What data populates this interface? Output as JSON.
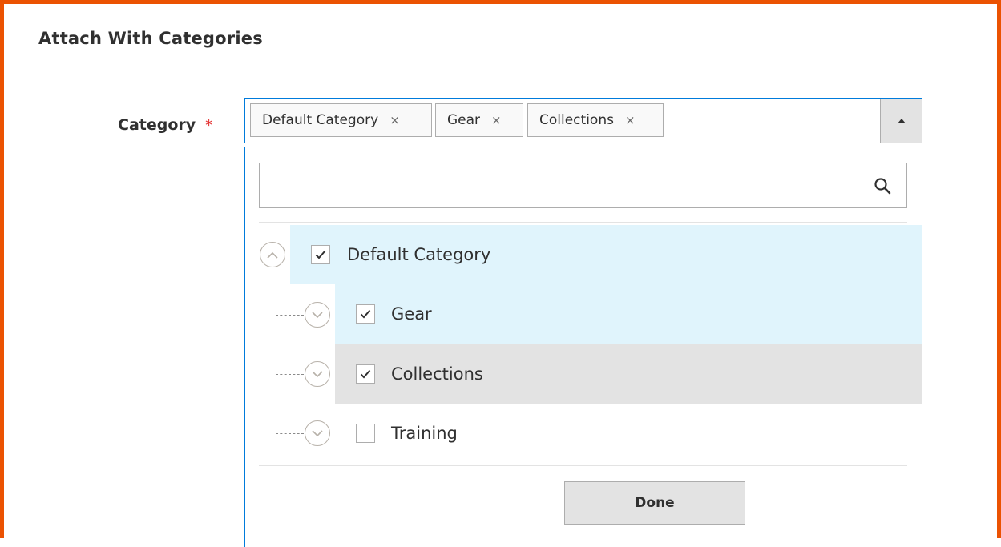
{
  "section": {
    "title": "Attach With Categories"
  },
  "field": {
    "label": "Category",
    "required_mark": "*"
  },
  "selected_chips": [
    {
      "label": "Default Category",
      "remove": "×"
    },
    {
      "label": "Gear",
      "remove": "×"
    },
    {
      "label": "Collections",
      "remove": "×"
    }
  ],
  "search": {
    "value": "",
    "placeholder": ""
  },
  "tree": {
    "root": {
      "label": "Default Category",
      "checked": true,
      "expanded": true
    },
    "children": [
      {
        "label": "Gear",
        "checked": true,
        "expanded": false
      },
      {
        "label": "Collections",
        "checked": true,
        "expanded": false
      },
      {
        "label": "Training",
        "checked": false,
        "expanded": false
      }
    ]
  },
  "actions": {
    "done_label": "Done"
  },
  "colors": {
    "frame_border": "#eb5202",
    "focus_border": "#007bdb",
    "selected_row": "#e0f4fc",
    "hover_row": "#e3e3e3",
    "required": "#e22626"
  }
}
